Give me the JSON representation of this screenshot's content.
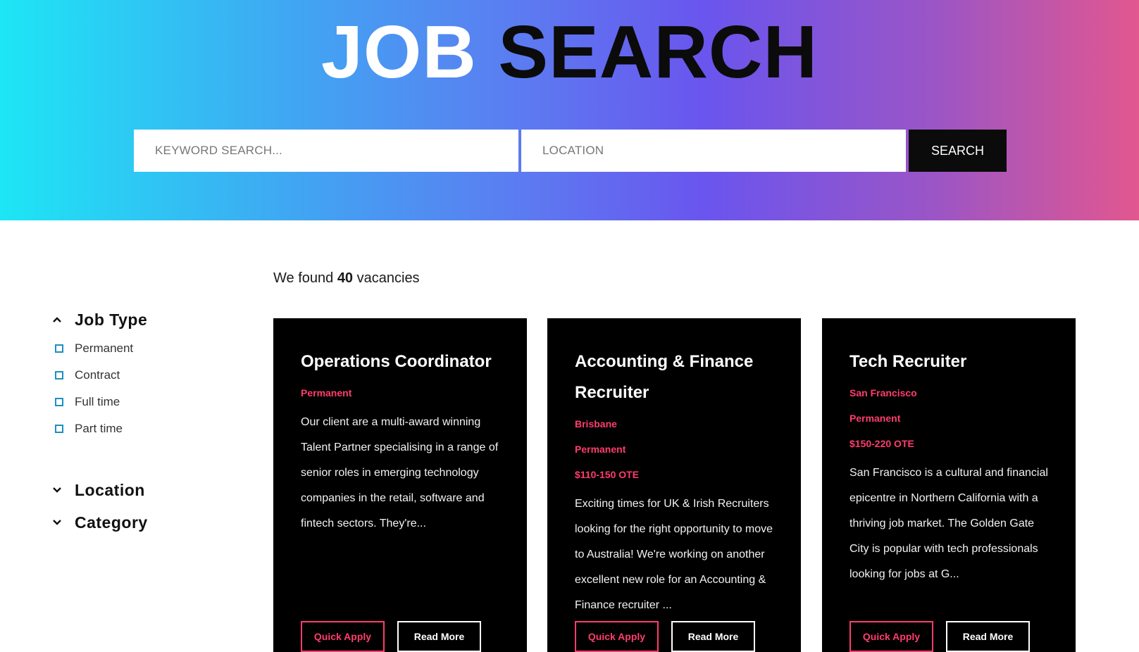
{
  "header": {
    "title_part1": "JOB",
    "title_part2": "SEARCH"
  },
  "search": {
    "keyword_placeholder": "KEYWORD SEARCH...",
    "keyword_value": "",
    "location_placeholder": "LOCATION",
    "location_value": "",
    "button_label": "SEARCH"
  },
  "results": {
    "prefix": "We found",
    "count": "40",
    "suffix": "vacancies"
  },
  "filters": {
    "job_type": {
      "title": "Job Type",
      "expanded": true,
      "options": [
        "Permanent",
        "Contract",
        "Full time",
        "Part time"
      ]
    },
    "location": {
      "title": "Location",
      "expanded": false
    },
    "category": {
      "title": "Category",
      "expanded": false
    }
  },
  "jobs": [
    {
      "title": "Operations Coordinator",
      "meta": [
        "Permanent"
      ],
      "description": "Our client are a multi-award winning Talent Partner specialising in a range of senior roles in emerging technology companies in the retail, software and fintech sectors. They're...",
      "quick_apply_label": "Quick Apply",
      "read_more_label": "Read More"
    },
    {
      "title": "Accounting & Finance Recruiter",
      "meta": [
        "Brisbane",
        "Permanent",
        "$110-150 OTE"
      ],
      "description": "Exciting times for UK & Irish Recruiters looking for the right opportunity to move to Australia! We're working on another excellent new role for an Accounting & Finance recruiter ...",
      "quick_apply_label": "Quick Apply",
      "read_more_label": "Read More"
    },
    {
      "title": "Tech Recruiter",
      "meta": [
        "San Francisco",
        "Permanent",
        "$150-220 OTE"
      ],
      "description": "San Francisco is a cultural and financial epicentre in Northern California with a thriving job market. The Golden Gate City is popular with tech professionals looking for jobs at G...",
      "quick_apply_label": "Quick Apply",
      "read_more_label": "Read More"
    }
  ],
  "colors": {
    "accent": "#ff3d6c",
    "checkbox": "#1f8fbf",
    "card_bg": "#000000"
  }
}
